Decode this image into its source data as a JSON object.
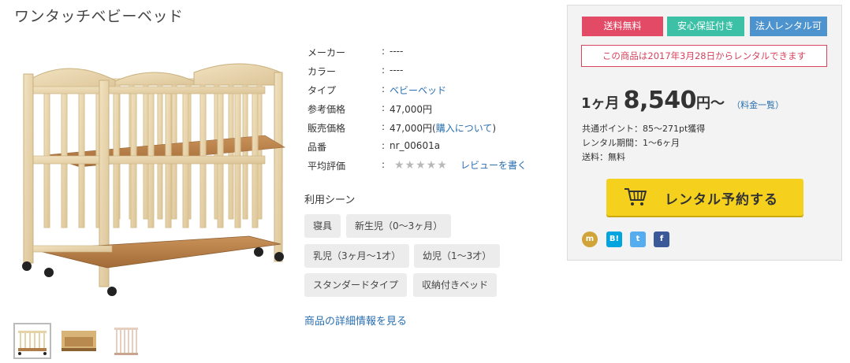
{
  "product": {
    "title": "ワンタッチベビーベッド"
  },
  "specs": {
    "maker": {
      "label": "メーカー",
      "value": "----"
    },
    "color": {
      "label": "カラー",
      "value": "----"
    },
    "type": {
      "label": "タイプ",
      "value": "ベビーベッド"
    },
    "ref_price": {
      "label": "参考価格",
      "value": "47,000円"
    },
    "sale_price": {
      "label": "販売価格",
      "value": "47,000円",
      "link_open": "(",
      "link": "購入について",
      "link_close": ")"
    },
    "sku": {
      "label": "品番",
      "value": "nr_00601a"
    },
    "rating": {
      "label": "平均評価",
      "stars": "★★★★★",
      "review_link": "レビューを書く",
      "score": 0
    }
  },
  "colon": ":",
  "scenes": {
    "heading": "利用シーン",
    "tags": [
      "寝具",
      "新生児（0〜3ヶ月）",
      "乳児（3ヶ月〜1才）",
      "幼児（1〜3才）",
      "スタンダードタイプ",
      "収納付きベッド"
    ]
  },
  "details_link": "商品の詳細情報を見る",
  "panel": {
    "badges": [
      {
        "label": "送料無料",
        "color": "#e24a66"
      },
      {
        "label": "安心保証付き",
        "color": "#3cc1a7"
      },
      {
        "label": "法人レンタル可",
        "color": "#4d94cf"
      }
    ],
    "notice": "この商品は2017年3月28日からレンタルできます",
    "price": {
      "period": "1ヶ月",
      "amount": "8,540",
      "suffix": "円〜",
      "fee_link": "（料金一覧）"
    },
    "points": "共通ポイント：85〜271pt獲得",
    "rental_period": "レンタル期間：1〜6ヶ月",
    "shipping": "送料：無料",
    "reserve_button": "レンタル予約する",
    "share": [
      {
        "icon": "mixi-check-icon",
        "glyph": "m",
        "color": "#d1a43a"
      },
      {
        "icon": "hatena-bookmark-icon",
        "glyph": "B!",
        "color": "#00a4de"
      },
      {
        "icon": "twitter-icon",
        "glyph": "t",
        "color": "#55acee"
      },
      {
        "icon": "facebook-icon",
        "glyph": "f",
        "color": "#3b5998"
      }
    ]
  }
}
